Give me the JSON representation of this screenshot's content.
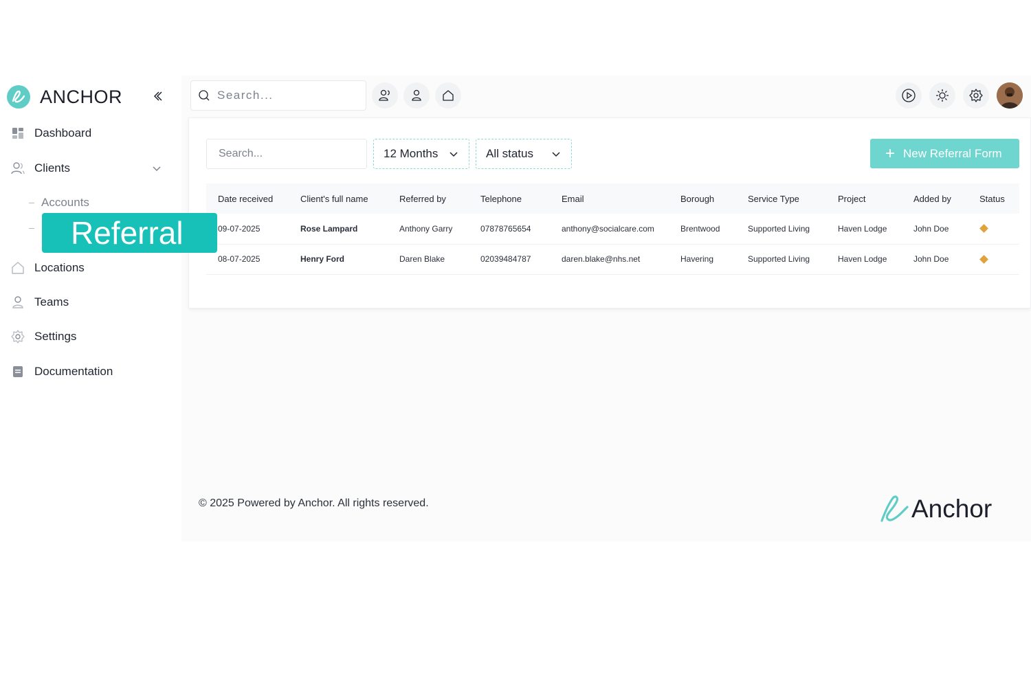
{
  "brand": {
    "name": "ANCHOR"
  },
  "sidebar": {
    "items": [
      {
        "label": "Dashboard"
      },
      {
        "label": "Clients"
      },
      {
        "label": "Locations"
      },
      {
        "label": "Teams"
      },
      {
        "label": "Settings"
      },
      {
        "label": "Documentation"
      }
    ],
    "sub_items": [
      {
        "label": "Accounts"
      },
      {
        "label": ""
      }
    ],
    "highlight_label": "Referral"
  },
  "topbar": {
    "search_placeholder": "Search..."
  },
  "filters": {
    "search_placeholder": "Search...",
    "period": "12 Months",
    "status": "All status",
    "new_button": "New Referral Form"
  },
  "table": {
    "headers": [
      "Date received",
      "Client's full name",
      "Referred by",
      "Telephone",
      "Email",
      "Borough",
      "Service Type",
      "Project",
      "Added by",
      "Status"
    ],
    "rows": [
      [
        "09-07-2025",
        "Rose Lampard",
        "Anthony Garry",
        "07878765654",
        "anthony@socialcare.com",
        "Brentwood",
        "Supported Living",
        "Haven Lodge",
        "John Doe"
      ],
      [
        "08-07-2025",
        "Henry Ford",
        "Daren Blake",
        "02039484787",
        "daren.blake@nhs.net",
        "Havering",
        "Supported Living",
        "Haven Lodge",
        "John Doe"
      ]
    ],
    "status_color": "#e0a23b"
  },
  "footer": {
    "copyright": "© 2025 Powered by Anchor. All rights reserved.",
    "logo_text": "Anchor"
  },
  "colors": {
    "accent": "#17c1b8",
    "button": "#6ed6cf"
  }
}
